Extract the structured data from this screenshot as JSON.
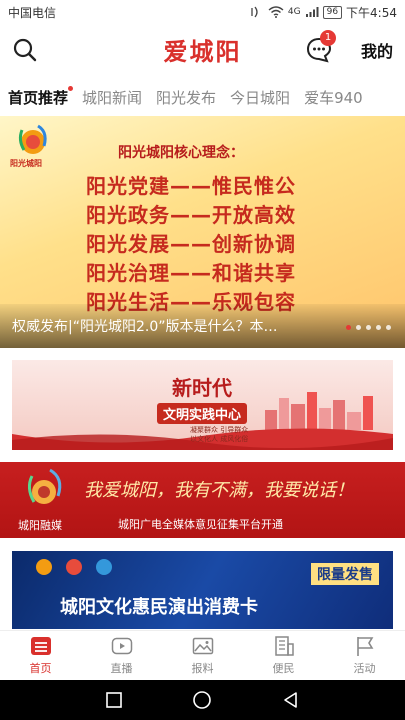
{
  "status_bar": {
    "carrier": "中国电信",
    "network": "4G",
    "battery": "96",
    "time": "下午4:54"
  },
  "header": {
    "brand": "爱城阳",
    "message_badge": "1",
    "mine_label": "我的"
  },
  "tabs": [
    {
      "label": "首页推荐",
      "active": true
    },
    {
      "label": "城阳新闻"
    },
    {
      "label": "阳光发布"
    },
    {
      "label": "今日城阳"
    },
    {
      "label": "爱车940"
    }
  ],
  "hero": {
    "logo_text": "阳光城阳",
    "title": "阳光城阳核心理念：",
    "lines": [
      "阳光党建——惟民惟公",
      "阳光政务——开放高效",
      "阳光发展——创新协调",
      "阳光治理——和谐共享",
      "阳光生活——乐观包容"
    ],
    "caption": "权威发布|“阳光城阳2.0”版本是什么？本…"
  },
  "banner1": {
    "title": "新时代",
    "subtitle": "文明实践中心",
    "small_1": "凝聚群众  引导群众",
    "small_2": "以文化人  成风化俗"
  },
  "banner2": {
    "logo_text": "城阳融媒",
    "title": "我爱城阳，我有不满，我要说话！",
    "subtitle": "城阳广电全媒体意见征集平台开通"
  },
  "banner3": {
    "badge": "限量发售",
    "title": "城阳文化惠民演出消费卡"
  },
  "bottom_nav": [
    {
      "label": "首页",
      "icon": "home-icon",
      "active": true
    },
    {
      "label": "直播",
      "icon": "live-icon"
    },
    {
      "label": "报料",
      "icon": "report-icon"
    },
    {
      "label": "便民",
      "icon": "service-icon"
    },
    {
      "label": "活动",
      "icon": "flag-icon"
    }
  ],
  "colors": {
    "brand_red": "#d9302c",
    "badge_red": "#e53935"
  }
}
